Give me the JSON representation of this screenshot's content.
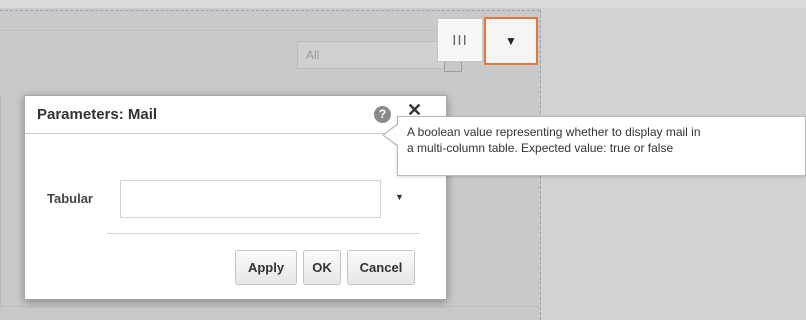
{
  "background": {
    "filter": {
      "value": "All"
    },
    "toolbar": {
      "columns_glyph": "III",
      "menu_glyph": "▼"
    }
  },
  "dialog": {
    "title": "Parameters: Mail",
    "help_glyph": "?",
    "close_glyph": "✕",
    "field": {
      "label": "Tabular",
      "value": "",
      "chevron": "▼"
    },
    "buttons": {
      "apply": "Apply",
      "ok": "OK",
      "cancel": "Cancel"
    }
  },
  "tooltip": {
    "line1": "A boolean value representing whether to display mail in",
    "line2": "a multi-column table. Expected value: true or false"
  },
  "colors": {
    "highlight": "#e07a3a",
    "dashed_border": "#8ea6c0"
  },
  "icons": [
    "columns-icon",
    "dropdown-icon",
    "help-icon",
    "close-icon",
    "chevron-down-icon"
  ]
}
